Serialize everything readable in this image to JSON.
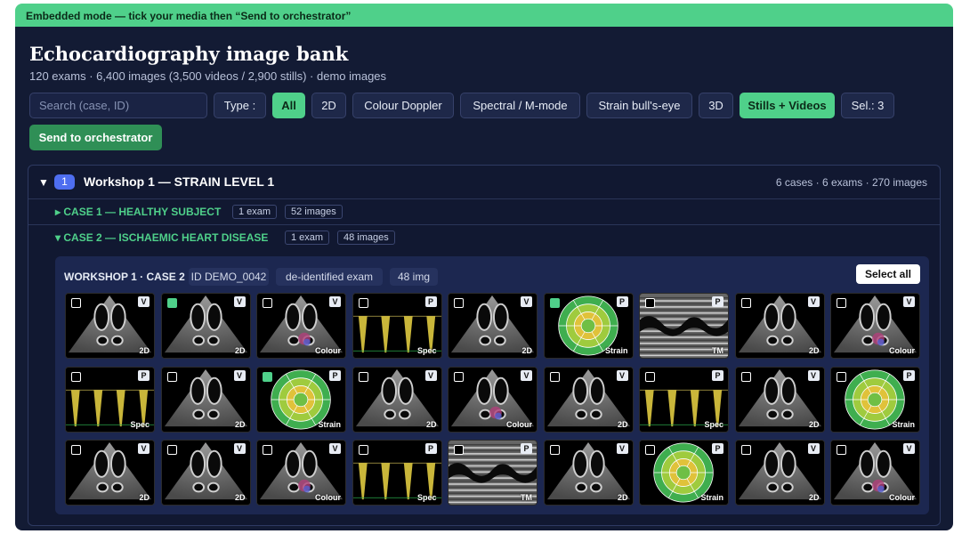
{
  "banner": {
    "text": "Embedded mode — tick your media then “Send to orchestrator”"
  },
  "header": {
    "title": "Echocardiography image bank",
    "subtitle": "120 exams · 6,400 images (3,500 videos / 2,900 stills) · demo images"
  },
  "search": {
    "placeholder": "Search (case, ID)"
  },
  "filters": {
    "type_label": "Type :",
    "types": [
      "All",
      "2D",
      "Colour Doppler",
      "Spectral / M-mode",
      "Strain bull's-eye",
      "3D"
    ],
    "active_type": "All",
    "media_toggle": "Stills + Videos",
    "selected": "Sel.: 3"
  },
  "actions": {
    "send_label": "Send to orchestrator"
  },
  "workshop": {
    "badge": "1",
    "title": "Workshop 1 — STRAIN LEVEL 1",
    "meta": "6 cases · 6 exams · 270 images",
    "cases": [
      {
        "caret": "▸",
        "title": "CASE 1 — HEALTHY SUBJECT",
        "exams": "1 exam",
        "images": "52 images",
        "expanded": false
      },
      {
        "caret": "▾",
        "title": "CASE 2 — ISCHAEMIC HEART DISEASE",
        "exams": "1 exam",
        "images": "48 images",
        "expanded": true
      }
    ]
  },
  "exam": {
    "title": "WORKSHOP 1 · CASE 2",
    "id": "ID DEMO_0042",
    "deid": "de-identified exam",
    "count": "48 img",
    "select_all": "Select all"
  },
  "tiles": [
    {
      "kind": "V",
      "label": "2D",
      "checked": false
    },
    {
      "kind": "V",
      "label": "2D",
      "checked": true
    },
    {
      "kind": "V",
      "label": "Colour",
      "checked": false
    },
    {
      "kind": "P",
      "label": "Spec",
      "checked": false
    },
    {
      "kind": "V",
      "label": "2D",
      "checked": false
    },
    {
      "kind": "P",
      "label": "Strain",
      "checked": true
    },
    {
      "kind": "P",
      "label": "TM",
      "checked": false
    },
    {
      "kind": "V",
      "label": "2D",
      "checked": false
    },
    {
      "kind": "V",
      "label": "Colour",
      "checked": false
    },
    {
      "kind": "P",
      "label": "Spec",
      "checked": false
    },
    {
      "kind": "V",
      "label": "2D",
      "checked": false
    },
    {
      "kind": "P",
      "label": "Strain",
      "checked": true
    },
    {
      "kind": "V",
      "label": "2D",
      "checked": false
    },
    {
      "kind": "V",
      "label": "Colour",
      "checked": false
    },
    {
      "kind": "V",
      "label": "2D",
      "checked": false
    },
    {
      "kind": "P",
      "label": "Spec",
      "checked": false
    },
    {
      "kind": "V",
      "label": "2D",
      "checked": false
    },
    {
      "kind": "P",
      "label": "Strain",
      "checked": false
    },
    {
      "kind": "V",
      "label": "2D",
      "checked": false
    },
    {
      "kind": "V",
      "label": "2D",
      "checked": false
    },
    {
      "kind": "V",
      "label": "Colour",
      "checked": false
    },
    {
      "kind": "P",
      "label": "Spec",
      "checked": false
    },
    {
      "kind": "P",
      "label": "TM",
      "checked": false
    },
    {
      "kind": "V",
      "label": "2D",
      "checked": false
    },
    {
      "kind": "P",
      "label": "Strain",
      "checked": false
    },
    {
      "kind": "V",
      "label": "2D",
      "checked": false
    },
    {
      "kind": "V",
      "label": "Colour",
      "checked": false
    }
  ],
  "colors": {
    "accent": "#4fd08a",
    "panel": "#131b34",
    "badge": "#4e6ef0"
  }
}
